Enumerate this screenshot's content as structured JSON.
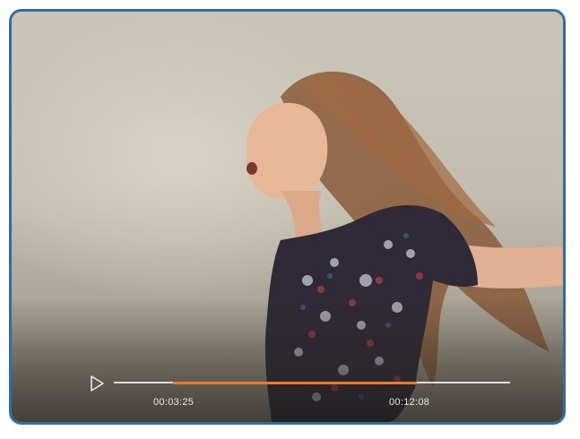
{
  "player": {
    "image_subject": "scene",
    "accent_color": "#f07a2a",
    "frame_color": "#2f6f99",
    "play_icon": "play-icon",
    "current_time": "00:03:25",
    "end_time": "00:12:08",
    "trim_start_fraction": 0.15,
    "trim_end_fraction": 0.765
  }
}
